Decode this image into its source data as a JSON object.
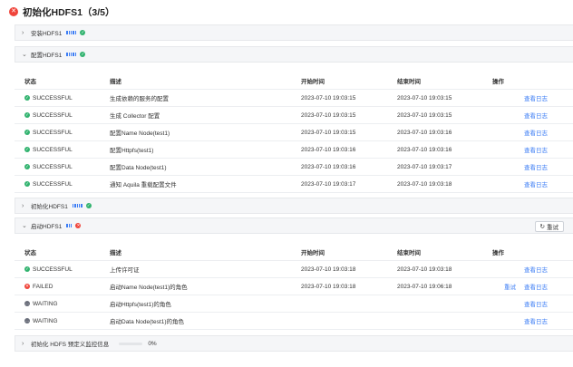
{
  "title": {
    "text": "初始化HDFS1（3/5）",
    "icon": "close-circle-icon"
  },
  "columns": {
    "status": "状态",
    "desc": "描述",
    "start": "开始时间",
    "end": "结束时间",
    "ops": "操作"
  },
  "sections": {
    "install": {
      "label": "安装HDFS1",
      "state": "success"
    },
    "configure": {
      "label": "配置HDFS1",
      "state": "success",
      "rows": [
        {
          "status": "SUCCESSFUL",
          "desc": "生成依赖的服务的配置",
          "start": "2023-07-10 19:03:15",
          "end": "2023-07-10 19:03:15",
          "log": "查看日志"
        },
        {
          "status": "SUCCESSFUL",
          "desc": "生成 Collector 配置",
          "start": "2023-07-10 19:03:15",
          "end": "2023-07-10 19:03:15",
          "log": "查看日志"
        },
        {
          "status": "SUCCESSFUL",
          "desc": "配置Name Node(test1)",
          "start": "2023-07-10 19:03:15",
          "end": "2023-07-10 19:03:16",
          "log": "查看日志"
        },
        {
          "status": "SUCCESSFUL",
          "desc": "配置Httpfs(test1)",
          "start": "2023-07-10 19:03:16",
          "end": "2023-07-10 19:03:16",
          "log": "查看日志"
        },
        {
          "status": "SUCCESSFUL",
          "desc": "配置Data Node(test1)",
          "start": "2023-07-10 19:03:16",
          "end": "2023-07-10 19:03:17",
          "log": "查看日志"
        },
        {
          "status": "SUCCESSFUL",
          "desc": "通知 Aquila 重载配置文件",
          "start": "2023-07-10 19:03:17",
          "end": "2023-07-10 19:03:18",
          "log": "查看日志"
        }
      ]
    },
    "init": {
      "label": "初始化HDFS1",
      "state": "success"
    },
    "start": {
      "label": "启动HDFS1",
      "state": "failed",
      "retry_label": "重试",
      "rows": [
        {
          "status": "SUCCESSFUL",
          "desc": "上传许可证",
          "start": "2023-07-10 19:03:18",
          "end": "2023-07-10 19:03:18",
          "retry": "",
          "log": "查看日志"
        },
        {
          "status": "FAILED",
          "desc": "启动Name Node(test1)的角色",
          "start": "2023-07-10 19:03:18",
          "end": "2023-07-10 19:06:18",
          "retry": "重试",
          "log": "查看日志"
        },
        {
          "status": "WAITING",
          "desc": "启动Httpfs(test1)的角色",
          "start": "",
          "end": "",
          "retry": "",
          "log": "查看日志"
        },
        {
          "status": "WAITING",
          "desc": "启动Data Node(test1)的角色",
          "start": "",
          "end": "",
          "retry": "",
          "log": "查看日志"
        }
      ]
    },
    "monitor": {
      "label": "初始化 HDFS 预定义监控信息",
      "progress_text": "0%",
      "progress": 0
    }
  },
  "colors": {
    "accent": "#3d7ef5",
    "success": "#32b36f",
    "failed": "#f0443a",
    "waiting": "#6b6f7b"
  }
}
